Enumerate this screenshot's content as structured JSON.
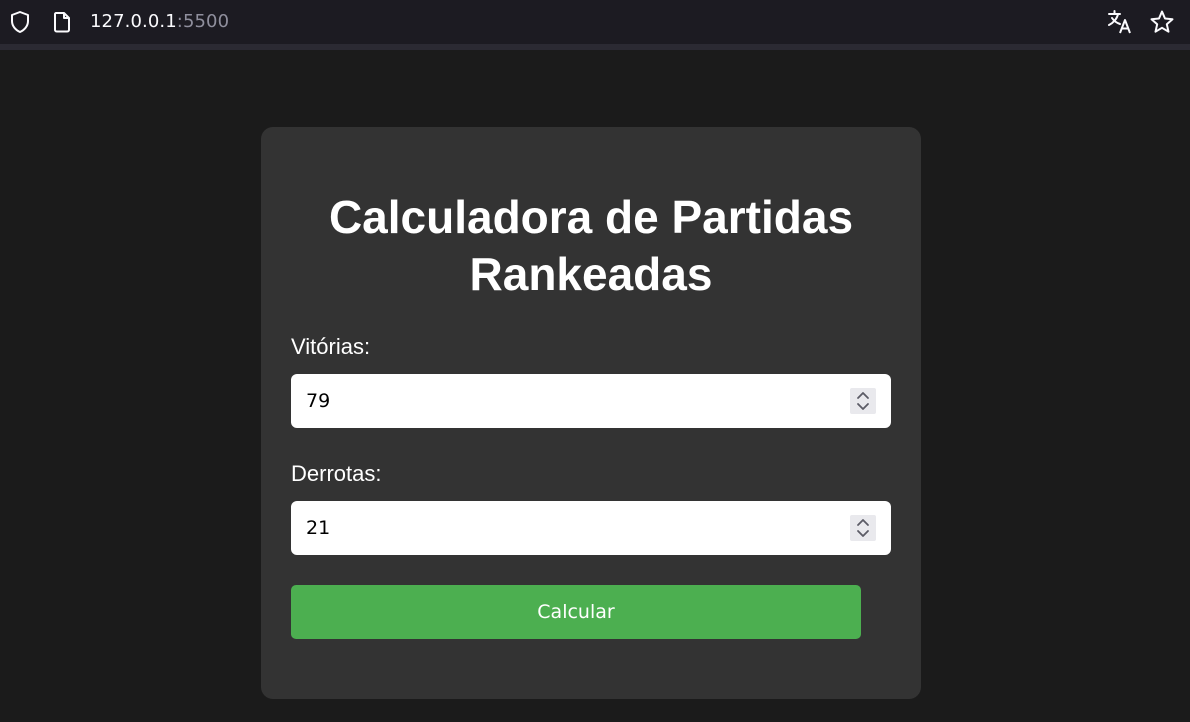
{
  "browser": {
    "url_host": "127.0.0.1",
    "url_port": ":5500",
    "icons": [
      "shield-icon",
      "page-icon",
      "translate-icon",
      "star-icon"
    ]
  },
  "card": {
    "title_line1": "Calculadora de Partidas",
    "title_line2": "Rankeadas",
    "wins_label": "Vitórias:",
    "wins_value": "79",
    "losses_label": "Derrotas:",
    "losses_value": "21",
    "button_label": "Calcular"
  },
  "colors": {
    "background": "#1b1b1b",
    "card": "#333333",
    "button": "#4caf50"
  }
}
